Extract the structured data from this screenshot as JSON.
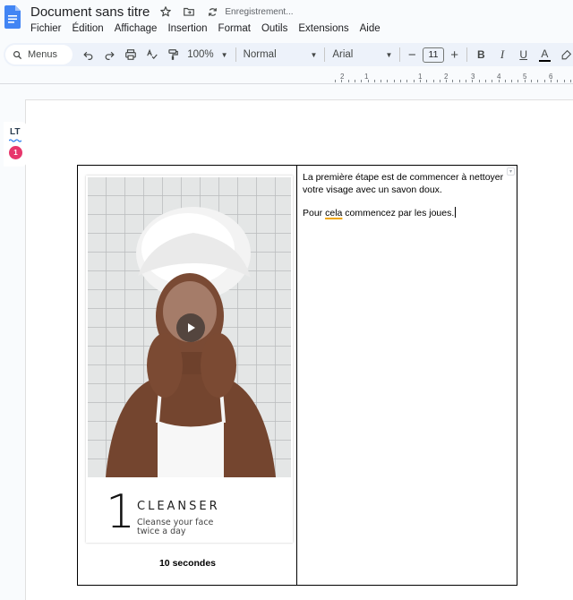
{
  "app": {
    "title": "Document sans titre",
    "save_status": "Enregistrement..."
  },
  "menu": [
    "Fichier",
    "Édition",
    "Affichage",
    "Insertion",
    "Format",
    "Outils",
    "Extensions",
    "Aide"
  ],
  "toolbar": {
    "search_label": "Menus",
    "zoom": "100%",
    "style": "Normal",
    "font": "Arial",
    "font_size": "11",
    "minus": "−",
    "plus": "+",
    "bold": "B",
    "italic": "I",
    "underline": "U",
    "text_color": "A"
  },
  "ruler": {
    "labels": [
      "2",
      "1",
      "1",
      "2",
      "3",
      "4",
      "5",
      "6"
    ]
  },
  "language_tool": {
    "logo": "LT",
    "issue_count": "1"
  },
  "table": {
    "card": {
      "step_number": "1",
      "step_title": "CLEANSER",
      "step_description": "Cleanse your face twice a day"
    },
    "duration": "10 secondes",
    "paragraph_1": "La première étape est de commencer à nettoyer votre visage avec un savon doux.",
    "paragraph_2": {
      "before": "Pour ",
      "flagged": "cela",
      "after": " commencez par les joues."
    }
  },
  "colors": {
    "docs_blue": "#4285f4",
    "toolbar_bg": "#edf2fa",
    "lt_badge": "#e7366c",
    "flag_underline": "#f0a500"
  }
}
